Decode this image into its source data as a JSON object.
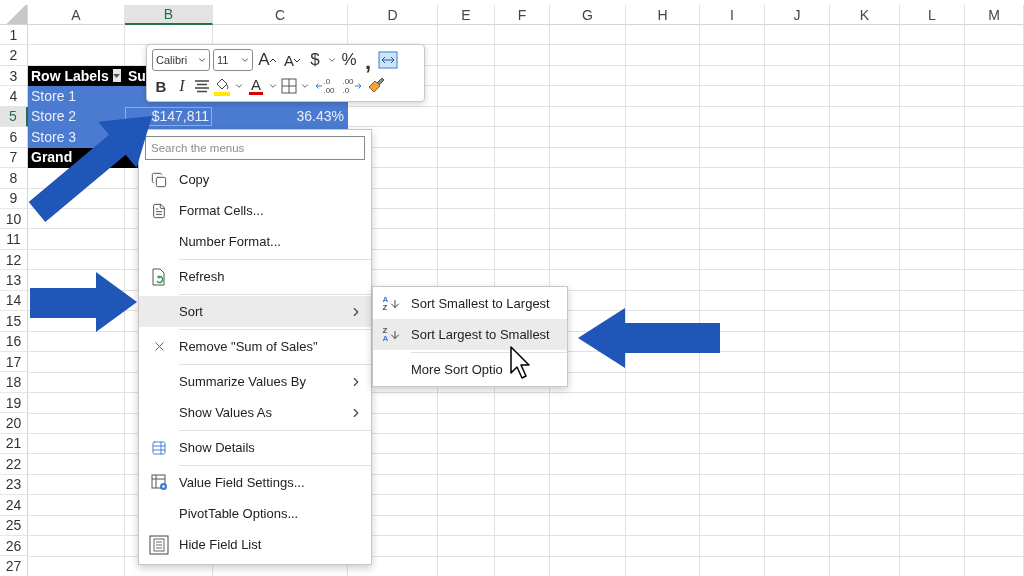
{
  "sheet": {
    "columns": [
      {
        "label": "A",
        "selected": false
      },
      {
        "label": "B",
        "selected": true
      },
      {
        "label": "C",
        "selected": false
      },
      {
        "label": "D",
        "selected": false
      },
      {
        "label": "E",
        "selected": false
      },
      {
        "label": "F",
        "selected": false
      },
      {
        "label": "G",
        "selected": false
      },
      {
        "label": "H",
        "selected": false
      },
      {
        "label": "I",
        "selected": false
      },
      {
        "label": "J",
        "selected": false
      },
      {
        "label": "K",
        "selected": false
      },
      {
        "label": "L",
        "selected": false
      },
      {
        "label": "M",
        "selected": false
      }
    ],
    "rows": [
      {
        "number": "1",
        "selected": false
      },
      {
        "number": "2",
        "selected": false
      },
      {
        "number": "3",
        "selected": false,
        "cells": [
          {
            "kind": "header",
            "text": "Row Labels",
            "filter": true,
            "selected": false
          },
          {
            "kind": "header",
            "text": "Su"
          }
        ]
      },
      {
        "number": "4",
        "selected": false,
        "cells": [
          {
            "kind": "label",
            "text": "Store 1",
            "selected": false
          },
          {
            "kind": "value"
          },
          {
            "kind": "value"
          }
        ]
      },
      {
        "number": "5",
        "selected": true,
        "cells": [
          {
            "kind": "label",
            "text": "Store 2",
            "selected": false
          },
          {
            "kind": "value",
            "text": "$147,811",
            "selected": true
          },
          {
            "kind": "value",
            "text": "36.43%",
            "selected": false
          }
        ]
      },
      {
        "number": "6",
        "selected": false,
        "cells": [
          {
            "kind": "label",
            "text": "Store 3",
            "selected": false
          },
          {
            "kind": "value"
          },
          {
            "kind": "value"
          }
        ]
      },
      {
        "number": "7",
        "selected": false,
        "cells": [
          {
            "kind": "header",
            "text": "Grand",
            "selected": false
          },
          {
            "kind": "header"
          }
        ]
      },
      {
        "number": "8",
        "selected": false
      },
      {
        "number": "9",
        "selected": false
      },
      {
        "number": "10",
        "selected": false
      },
      {
        "number": "11",
        "selected": false
      },
      {
        "number": "12",
        "selected": false
      },
      {
        "number": "13",
        "selected": false
      },
      {
        "number": "14",
        "selected": false
      },
      {
        "number": "15",
        "selected": false
      },
      {
        "number": "16",
        "selected": false
      },
      {
        "number": "17",
        "selected": false
      },
      {
        "number": "18",
        "selected": false
      },
      {
        "number": "19",
        "selected": false
      },
      {
        "number": "20",
        "selected": false
      },
      {
        "number": "21",
        "selected": false
      },
      {
        "number": "22",
        "selected": false
      },
      {
        "number": "23",
        "selected": false
      },
      {
        "number": "24",
        "selected": false
      },
      {
        "number": "25",
        "selected": false
      },
      {
        "number": "26",
        "selected": false
      },
      {
        "number": "27",
        "selected": false
      }
    ]
  },
  "mini_toolbar": {
    "font_row": [
      {
        "kind": "font",
        "value": "Calibri"
      },
      {
        "kind": "size",
        "value": "11"
      },
      {
        "kind": "grow",
        "label": "A"
      },
      {
        "kind": "shrink",
        "label": "A"
      },
      {
        "kind": "symbol",
        "label": "$"
      },
      {
        "kind": "caret"
      },
      {
        "kind": "symbol",
        "label": "%"
      },
      {
        "kind": "comma",
        "label": ","
      },
      {
        "kind": "wrap"
      }
    ],
    "format_row": [
      {
        "kind": "bold",
        "label": "B"
      },
      {
        "kind": "italic",
        "label": "I"
      },
      {
        "kind": "align"
      },
      {
        "kind": "fill"
      },
      {
        "kind": "caret"
      },
      {
        "kind": "font-color",
        "label": "A"
      },
      {
        "kind": "caret"
      },
      {
        "kind": "borders"
      },
      {
        "kind": "caret"
      },
      {
        "kind": "add-decimal",
        "top": ".0",
        "bottom": ".00"
      },
      {
        "kind": "remove-decimal",
        "top": ".00",
        "bottom": ".0"
      },
      {
        "kind": "painter"
      }
    ]
  },
  "context_menu": {
    "search_placeholder": "Search the menus",
    "items": [
      {
        "kind": "copy",
        "label": "Copy",
        "submenu": false,
        "selected": false
      },
      {
        "kind": "format-cells",
        "label": "Format Cells...",
        "submenu": false,
        "selected": false
      },
      {
        "kind": "plain",
        "label": "Number Format...",
        "submenu": false,
        "selected": false
      },
      {
        "kind": "separator"
      },
      {
        "kind": "refresh",
        "label": "Refresh",
        "submenu": false,
        "selected": false
      },
      {
        "kind": "separator"
      },
      {
        "kind": "plain",
        "label": "Sort",
        "submenu": true,
        "selected": true
      },
      {
        "kind": "separator"
      },
      {
        "kind": "remove",
        "label": "Remove \"Sum of Sales\"",
        "submenu": false,
        "selected": false
      },
      {
        "kind": "separator"
      },
      {
        "kind": "plain",
        "label": "Summarize Values By",
        "submenu": true,
        "selected": false
      },
      {
        "kind": "plain",
        "label": "Show Values As",
        "submenu": true,
        "selected": false
      },
      {
        "kind": "separator"
      },
      {
        "kind": "details",
        "label": "Show Details",
        "submenu": false,
        "selected": false
      },
      {
        "kind": "separator"
      },
      {
        "kind": "field-settings",
        "label": "Value Field Settings...",
        "submenu": false,
        "selected": false
      },
      {
        "kind": "plain",
        "label": "PivotTable Options...",
        "submenu": false,
        "selected": false
      },
      {
        "kind": "field-list",
        "label": "Hide Field List",
        "submenu": false,
        "selected": false
      }
    ]
  },
  "sort_submenu": {
    "items": [
      {
        "kind": "sort-asc",
        "letters": [
          "A",
          "Z"
        ],
        "label": "Sort Smallest to Largest",
        "selected": false
      },
      {
        "kind": "sort-desc",
        "letters": [
          "Z",
          "A"
        ],
        "label": "Sort Largest to Smallest",
        "selected": true
      },
      {
        "kind": "separator"
      },
      {
        "kind": "plain",
        "label": "More Sort Optio",
        "selected": false
      }
    ]
  }
}
